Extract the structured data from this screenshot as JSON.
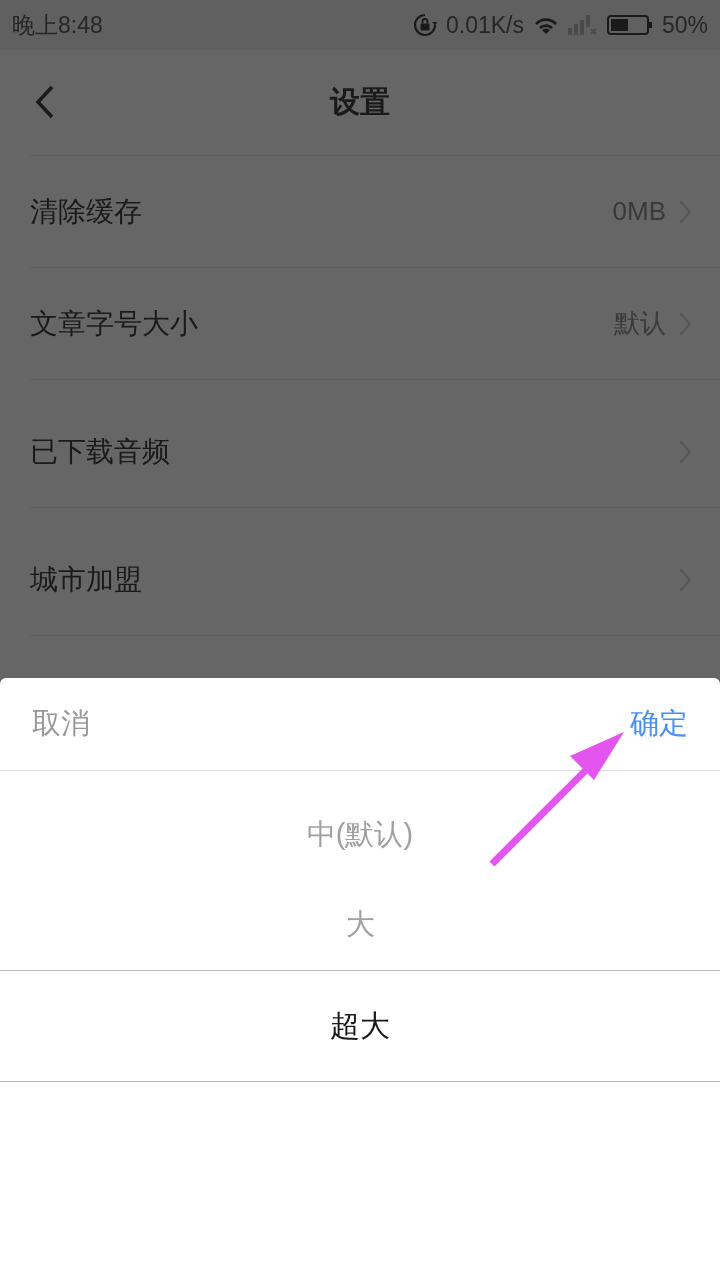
{
  "status_bar": {
    "time": "晚上8:48",
    "network_speed": "0.01K/s",
    "battery": "50%"
  },
  "header": {
    "title": "设置"
  },
  "settings": [
    {
      "label": "清除缓存",
      "value": "0MB"
    },
    {
      "label": "文章字号大小",
      "value": "默认"
    },
    {
      "label": "已下载音频"
    },
    {
      "label": "城市加盟"
    }
  ],
  "picker": {
    "cancel": "取消",
    "confirm": "确定",
    "options": [
      {
        "label": "中(默认)",
        "selected": false
      },
      {
        "label": "大",
        "selected": false
      },
      {
        "label": "超大",
        "selected": true
      }
    ]
  }
}
